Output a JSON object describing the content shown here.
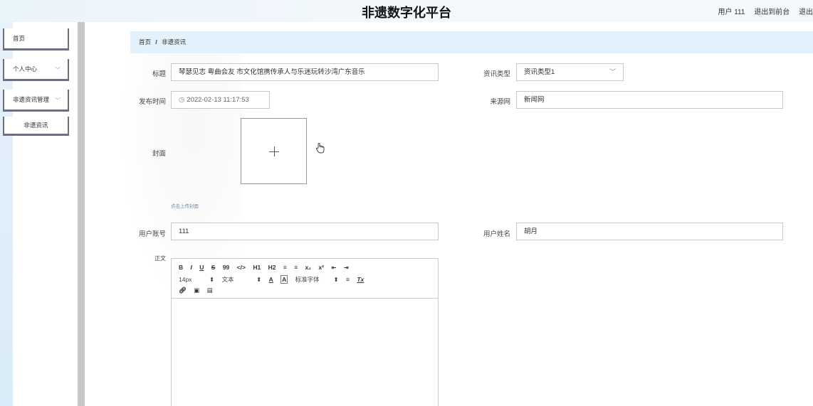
{
  "header": {
    "title": "非遗数字化平台",
    "user_label": "用户 111",
    "exit_front": "退出到前台",
    "logout": "退出"
  },
  "sidebar": {
    "items": [
      {
        "label": "首页"
      },
      {
        "label": "个人中心"
      },
      {
        "label": "非遗资讯管理"
      },
      {
        "label": "非遗资讯"
      }
    ]
  },
  "breadcrumb": {
    "home": "首页",
    "separator": "/",
    "current": "非遗资讯"
  },
  "form": {
    "title_label": "标题",
    "title_value": "琴瑟见志 粤曲会友 市文化馆携传承人与乐迷玩转沙湾广东音乐",
    "type_label": "资讯类型",
    "type_value": "资讯类型1",
    "publish_time_label": "发布时间",
    "publish_time_value": "2022-02-13 11:17:53",
    "source_label": "来源网",
    "source_value": "新闻网",
    "cover_label": "封面",
    "cover_hint": "点击上传封面",
    "account_label": "用户账号",
    "account_value": "111",
    "username_label": "用户姓名",
    "username_value": "胡月",
    "content_label": "正文"
  },
  "editor": {
    "row1": [
      "B",
      "I",
      "U",
      "S",
      "99",
      "</>",
      "H1",
      "H2",
      "≡",
      "≡",
      "x₂",
      "x²",
      "⇤",
      "⇥"
    ],
    "font_size": "14px",
    "text_style": "文本",
    "font_family": "标准字体",
    "row2_tail": "Tx"
  },
  "colors": {
    "accent_bg": "#e2f1fb",
    "menu_border": "#6b6f86"
  },
  "icons": {
    "clock": "clock-icon",
    "chevron": "chevron-down-icon",
    "plus": "plus-icon",
    "hand": "hand-cursor-icon"
  }
}
